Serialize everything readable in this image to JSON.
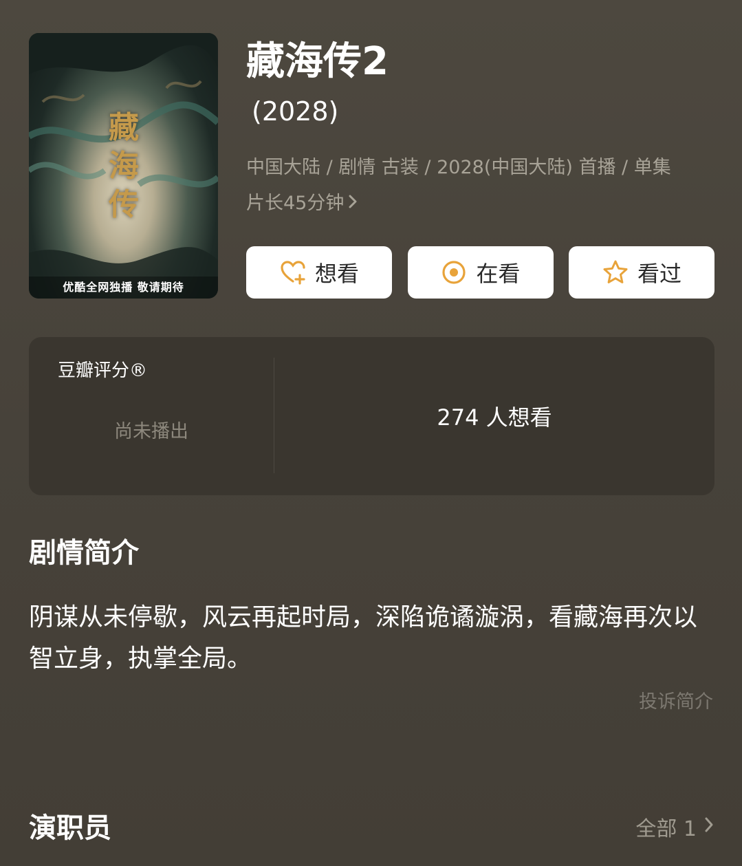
{
  "poster": {
    "calligraphy": "藏海传",
    "tagline": "优酷全网独播 敬请期待"
  },
  "show": {
    "title": "藏海传2",
    "year": "(2028)",
    "meta_line1": "中国大陆 / 剧情 古装 / 2028(中国大陆) 首播 / 单集",
    "meta_line2": "片长45分钟"
  },
  "actions": [
    {
      "label": "想看",
      "icon": "heart-plus-icon"
    },
    {
      "label": "在看",
      "icon": "target-circle-icon"
    },
    {
      "label": "看过",
      "icon": "star-outline-icon"
    }
  ],
  "rating": {
    "label": "豆瓣评分®",
    "status": "尚未播出",
    "want_count": "274 人想看"
  },
  "synopsis": {
    "heading": "剧情简介",
    "text": "阴谋从未停歇，风云再起时局，深陷诡谲漩涡，看藏海再次以智立身，执掌全局。",
    "report_label": "投诉简介"
  },
  "cast": {
    "heading": "演职员",
    "all_label": "全部 1"
  },
  "colors": {
    "background": "#4a453d",
    "panel": "#3a362f",
    "accent_orange": "#e8a33a",
    "muted_text": "#a8a397"
  }
}
